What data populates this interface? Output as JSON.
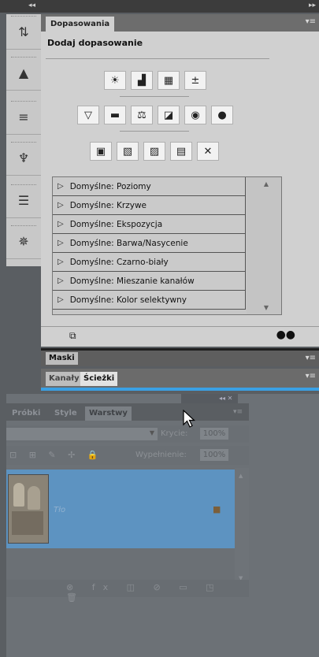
{
  "top_strip": {
    "collapse_left": "◂◂",
    "collapse_right": "▸▸"
  },
  "dock": {
    "icons": [
      "history-icon",
      "histogram-icon",
      "brush-presets-icon",
      "clone-source-icon",
      "layer-comps-icon",
      "navigator-icon"
    ],
    "glyphs": [
      "⇅",
      "▲",
      "≡",
      "♆",
      "☰",
      "✵"
    ]
  },
  "adjustments_panel": {
    "tab": "Dopasowania",
    "menu_glyph": "▾≡",
    "title": "Dodaj dopasowanie",
    "row1": [
      "☀",
      "▟",
      "▦",
      "±"
    ],
    "row2": [
      "▽",
      "▬",
      "⚖",
      "◪",
      "◉",
      "●"
    ],
    "row3": [
      "▣",
      "▧",
      "▨",
      "▤",
      "✕"
    ],
    "presets": [
      "Domyślne: Poziomy",
      "Domyślne: Krzywe",
      "Domyślne: Ekspozycja",
      "Domyślne: Barwa/Nasycenie",
      "Domyślne: Czarno-biały",
      "Domyślne: Mieszanie kanałów",
      "Domyślne: Kolor selektywny"
    ],
    "footer_left": "⧉",
    "footer_right": "●●"
  },
  "masks_panel": {
    "tab": "Maski",
    "menu_glyph": "▾≡"
  },
  "channels_panel": {
    "tab1": "Kanały",
    "tab2": "Ścieżki",
    "menu_glyph": "▾≡"
  },
  "ghost_panel": {
    "collapse": "◂◂  ✕",
    "tabs": [
      "Próbki",
      "Style",
      "Warstwy"
    ],
    "menu_glyph": "▾≡",
    "opacity_label": "Krycie:",
    "opacity_value": "100%",
    "fill_label": "Wypełnienie:",
    "fill_value": "100%",
    "lock_icons": "⊡ ⊞ ✎ ✢ 🔒",
    "layer_name": "Tło",
    "footer_icons": "⊗ fx ◫ ⊘ ▭ ◳ 🗑"
  }
}
